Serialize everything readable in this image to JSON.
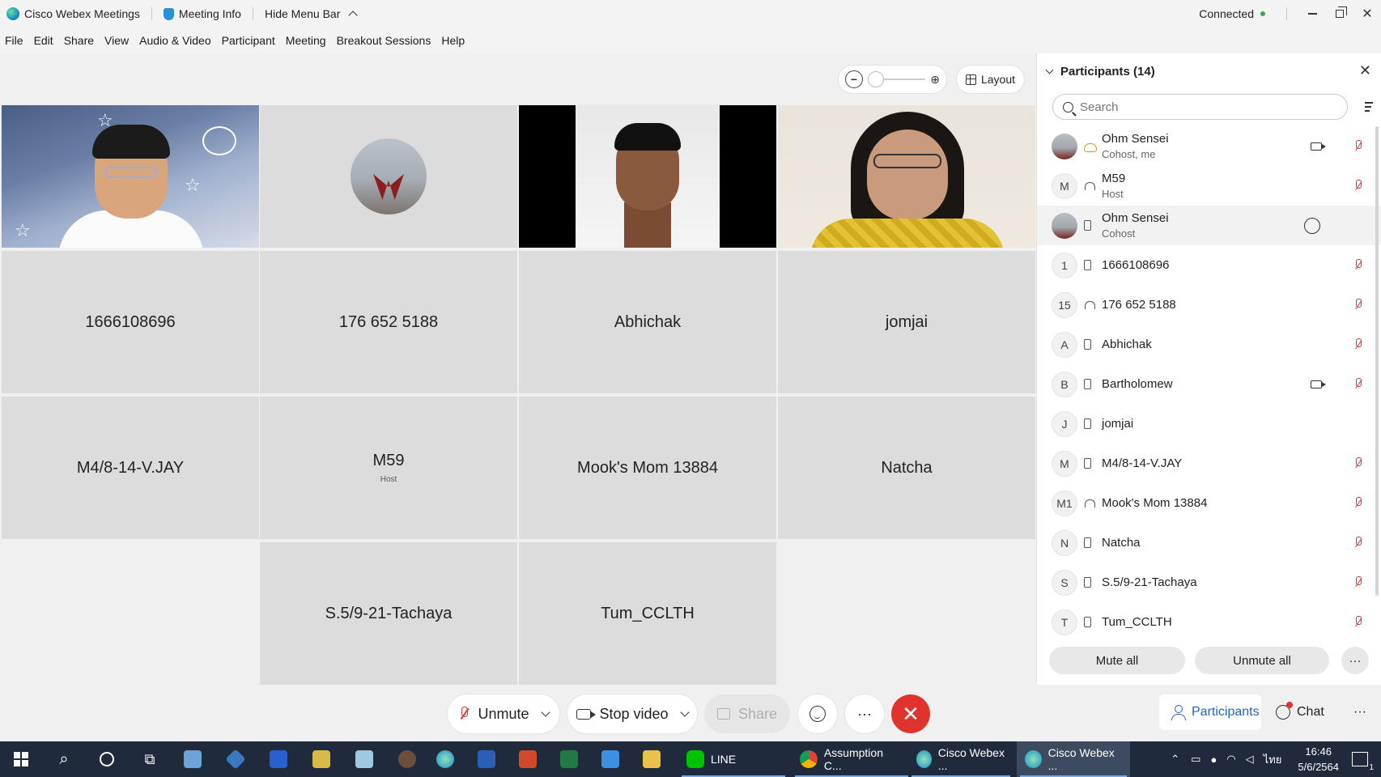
{
  "titlebar": {
    "app_name": "Cisco Webex Meetings",
    "meeting_info": "Meeting Info",
    "hide_menu": "Hide Menu Bar",
    "status": "Connected"
  },
  "menu": [
    "File",
    "Edit",
    "Share",
    "View",
    "Audio & Video",
    "Participant",
    "Meeting",
    "Breakout Sessions",
    "Help"
  ],
  "toolbar": {
    "layout_label": "Layout"
  },
  "tiles": [
    {
      "name": "1666108696",
      "sub": ""
    },
    {
      "name": "176 652 5188",
      "sub": ""
    },
    {
      "name": "Abhichak",
      "sub": ""
    },
    {
      "name": "jomjai",
      "sub": ""
    },
    {
      "name": "M4/8-14-V.JAY",
      "sub": ""
    },
    {
      "name": "M59",
      "sub": "Host"
    },
    {
      "name": "Mook's Mom 13884",
      "sub": ""
    },
    {
      "name": "Natcha",
      "sub": ""
    },
    {
      "name": "S.5/9-21-Tachaya",
      "sub": ""
    },
    {
      "name": "Tum_CCLTH",
      "sub": ""
    }
  ],
  "controls": {
    "unmute": "Unmute",
    "stop_video": "Stop video",
    "share": "Share",
    "more": "···",
    "end": "✕"
  },
  "panel": {
    "title": "Participants (14)",
    "search_placeholder": "Search",
    "participants": [
      {
        "initial": "",
        "name": "Ohm Sensei",
        "role": "Cohost, me"
      },
      {
        "initial": "M",
        "name": "M59",
        "role": "Host"
      },
      {
        "initial": "",
        "name": "Ohm Sensei",
        "role": "Cohost"
      },
      {
        "initial": "1",
        "name": "1666108696",
        "role": ""
      },
      {
        "initial": "15",
        "name": "176 652 5188",
        "role": ""
      },
      {
        "initial": "A",
        "name": "Abhichak",
        "role": ""
      },
      {
        "initial": "B",
        "name": "Bartholomew",
        "role": ""
      },
      {
        "initial": "J",
        "name": "jomjai",
        "role": ""
      },
      {
        "initial": "M",
        "name": "M4/8-14-V.JAY",
        "role": ""
      },
      {
        "initial": "M1",
        "name": "Mook's Mom 13884",
        "role": ""
      },
      {
        "initial": "N",
        "name": "Natcha",
        "role": ""
      },
      {
        "initial": "S",
        "name": "S.5/9-21-Tachaya",
        "role": ""
      },
      {
        "initial": "T",
        "name": "Tum_CCLTH",
        "role": ""
      }
    ],
    "mute_all": "Mute all",
    "unmute_all": "Unmute all",
    "more": "···"
  },
  "bottom_tabs": {
    "participants": "Participants",
    "chat": "Chat",
    "more": "···"
  },
  "taskbar": {
    "line": "LINE",
    "chrome": "Assumption C...",
    "webex1": "Cisco Webex ...",
    "webex2": "Cisco Webex ...",
    "lang": "ไทย",
    "time": "16:46",
    "date": "5/6/2564",
    "notif_count": "1"
  }
}
